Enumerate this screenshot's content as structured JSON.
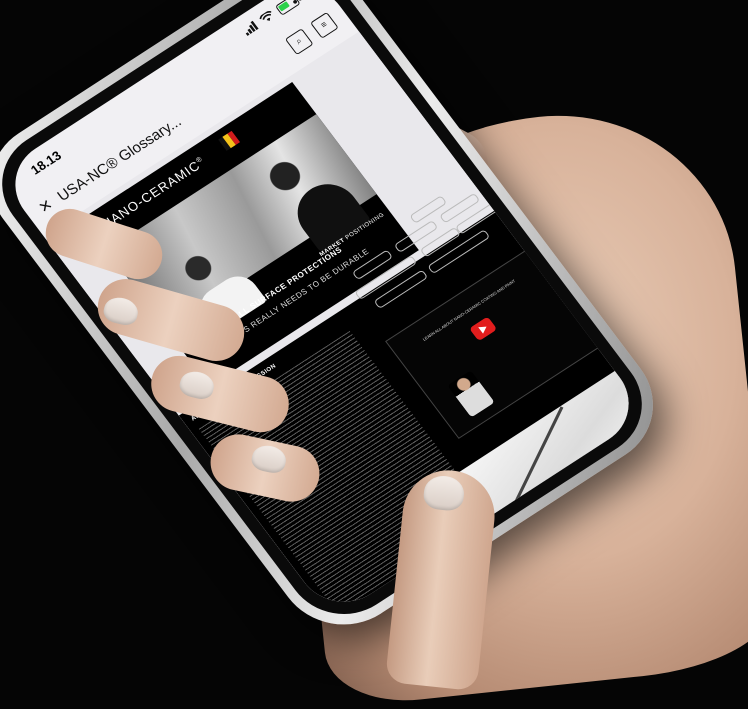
{
  "status_bar": {
    "time": "18.13",
    "signal_icon": "signal-bars-icon",
    "wifi_icon": "wifi-icon",
    "battery_icon": "battery-charging-icon",
    "more_indicator": "•••"
  },
  "browser_header": {
    "close_label": "×",
    "title": "USA-NC® Glossary...",
    "search_icon": "search-document-icon",
    "reader_icon": "reader-mode-icon"
  },
  "document": {
    "brand": "NANO-CERAMIC",
    "registered_mark": "®",
    "brand_subtitle": "",
    "hero_heading": "ALL SURFACE PROTECTIONS",
    "hero_subheading": "IF IT'S REALLY NEEDS TO BE DURABLE",
    "about_heading": "ABOUT US AND OUR MISSION",
    "market_heading_1": "MARKET",
    "market_heading_2": "POSITIONING",
    "video_caption": "LEARN ALL ABOUT NANO-CERAMIC COATING AND PAINT"
  },
  "colors": {
    "background": "#050505",
    "screen": "#f1f0f3",
    "page_black": "#000000",
    "play_button": "#e21d1d",
    "flag": [
      "#111111",
      "#f4c21b",
      "#d11c1c"
    ]
  }
}
